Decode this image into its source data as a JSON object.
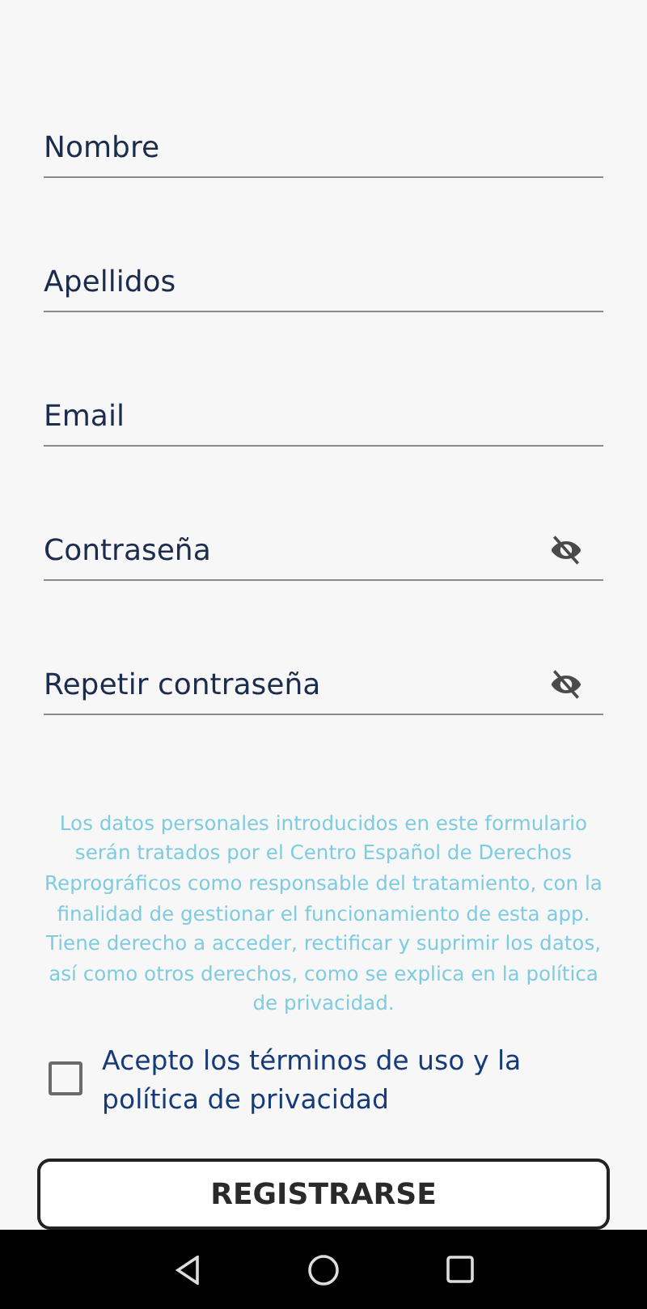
{
  "fields": [
    {
      "kind": "text",
      "placeholder": "Nombre"
    },
    {
      "kind": "text",
      "placeholder": "Apellidos"
    },
    {
      "kind": "text",
      "placeholder": "Email"
    },
    {
      "kind": "password",
      "placeholder": "Contraseña"
    },
    {
      "kind": "password",
      "placeholder": "Repetir contraseña"
    }
  ],
  "privacy_notice": "Los datos personales introducidos en este formulario serán tratados por el Centro Español de Derechos Reprográficos como responsable del tratamiento, con la finalidad de gestionar el funcionamiento de esta app. Tiene derecho a acceder, rectificar y suprimir los datos, así como otros derechos, como se explica en la política de privacidad.",
  "terms": {
    "label": "Acepto los términos de uso y la política de privacidad",
    "checked": false
  },
  "submit_button": "REGISTRARSE"
}
